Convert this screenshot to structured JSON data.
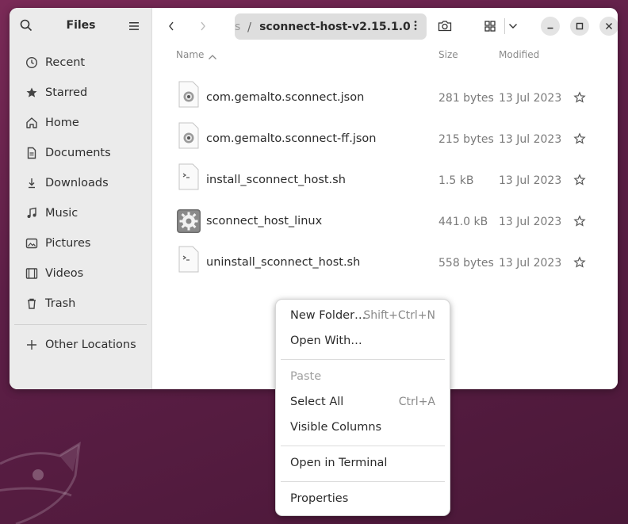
{
  "sidebar": {
    "title": "Files",
    "places": [
      {
        "label": "Recent",
        "icon": "clock-icon"
      },
      {
        "label": "Starred",
        "icon": "star-icon"
      },
      {
        "label": "Home",
        "icon": "home-icon"
      },
      {
        "label": "Documents",
        "icon": "document-icon"
      },
      {
        "label": "Downloads",
        "icon": "download-icon"
      },
      {
        "label": "Music",
        "icon": "music-icon"
      },
      {
        "label": "Pictures",
        "icon": "picture-icon"
      },
      {
        "label": "Videos",
        "icon": "video-icon"
      },
      {
        "label": "Trash",
        "icon": "trash-icon"
      }
    ],
    "other": {
      "label": "Other Locations",
      "icon": "plus-icon"
    }
  },
  "toolbar": {
    "path_fragment": "s",
    "path_separator": "/",
    "current_folder": "sconnect-host-v2.15.1.0"
  },
  "columns": {
    "name": "Name",
    "size": "Size",
    "modified": "Modified"
  },
  "files": [
    {
      "name": "com.gemalto.sconnect.json",
      "size": "281 bytes",
      "modified": "13 Jul 2023",
      "icon": "json-file-icon"
    },
    {
      "name": "com.gemalto.sconnect-ff.json",
      "size": "215 bytes",
      "modified": "13 Jul 2023",
      "icon": "json-file-icon"
    },
    {
      "name": "install_sconnect_host.sh",
      "size": "1.5 kB",
      "modified": "13 Jul 2023",
      "icon": "script-file-icon"
    },
    {
      "name": "sconnect_host_linux",
      "size": "441.0 kB",
      "modified": "13 Jul 2023",
      "icon": "executable-file-icon"
    },
    {
      "name": "uninstall_sconnect_host.sh",
      "size": "558 bytes",
      "modified": "13 Jul 2023",
      "icon": "script-file-icon"
    }
  ],
  "context_menu": {
    "new_folder": {
      "label": "New Folder…",
      "shortcut": "Shift+Ctrl+N"
    },
    "open_with": {
      "label": "Open With…"
    },
    "paste": {
      "label": "Paste"
    },
    "select_all": {
      "label": "Select All",
      "shortcut": "Ctrl+A"
    },
    "visible_columns": {
      "label": "Visible Columns"
    },
    "open_terminal": {
      "label": "Open in Terminal"
    },
    "properties": {
      "label": "Properties"
    }
  },
  "colors": {
    "wallpaper": "#5e1f47",
    "sidebar_bg": "#ebebeb",
    "pathbar_bg": "#dedede"
  }
}
